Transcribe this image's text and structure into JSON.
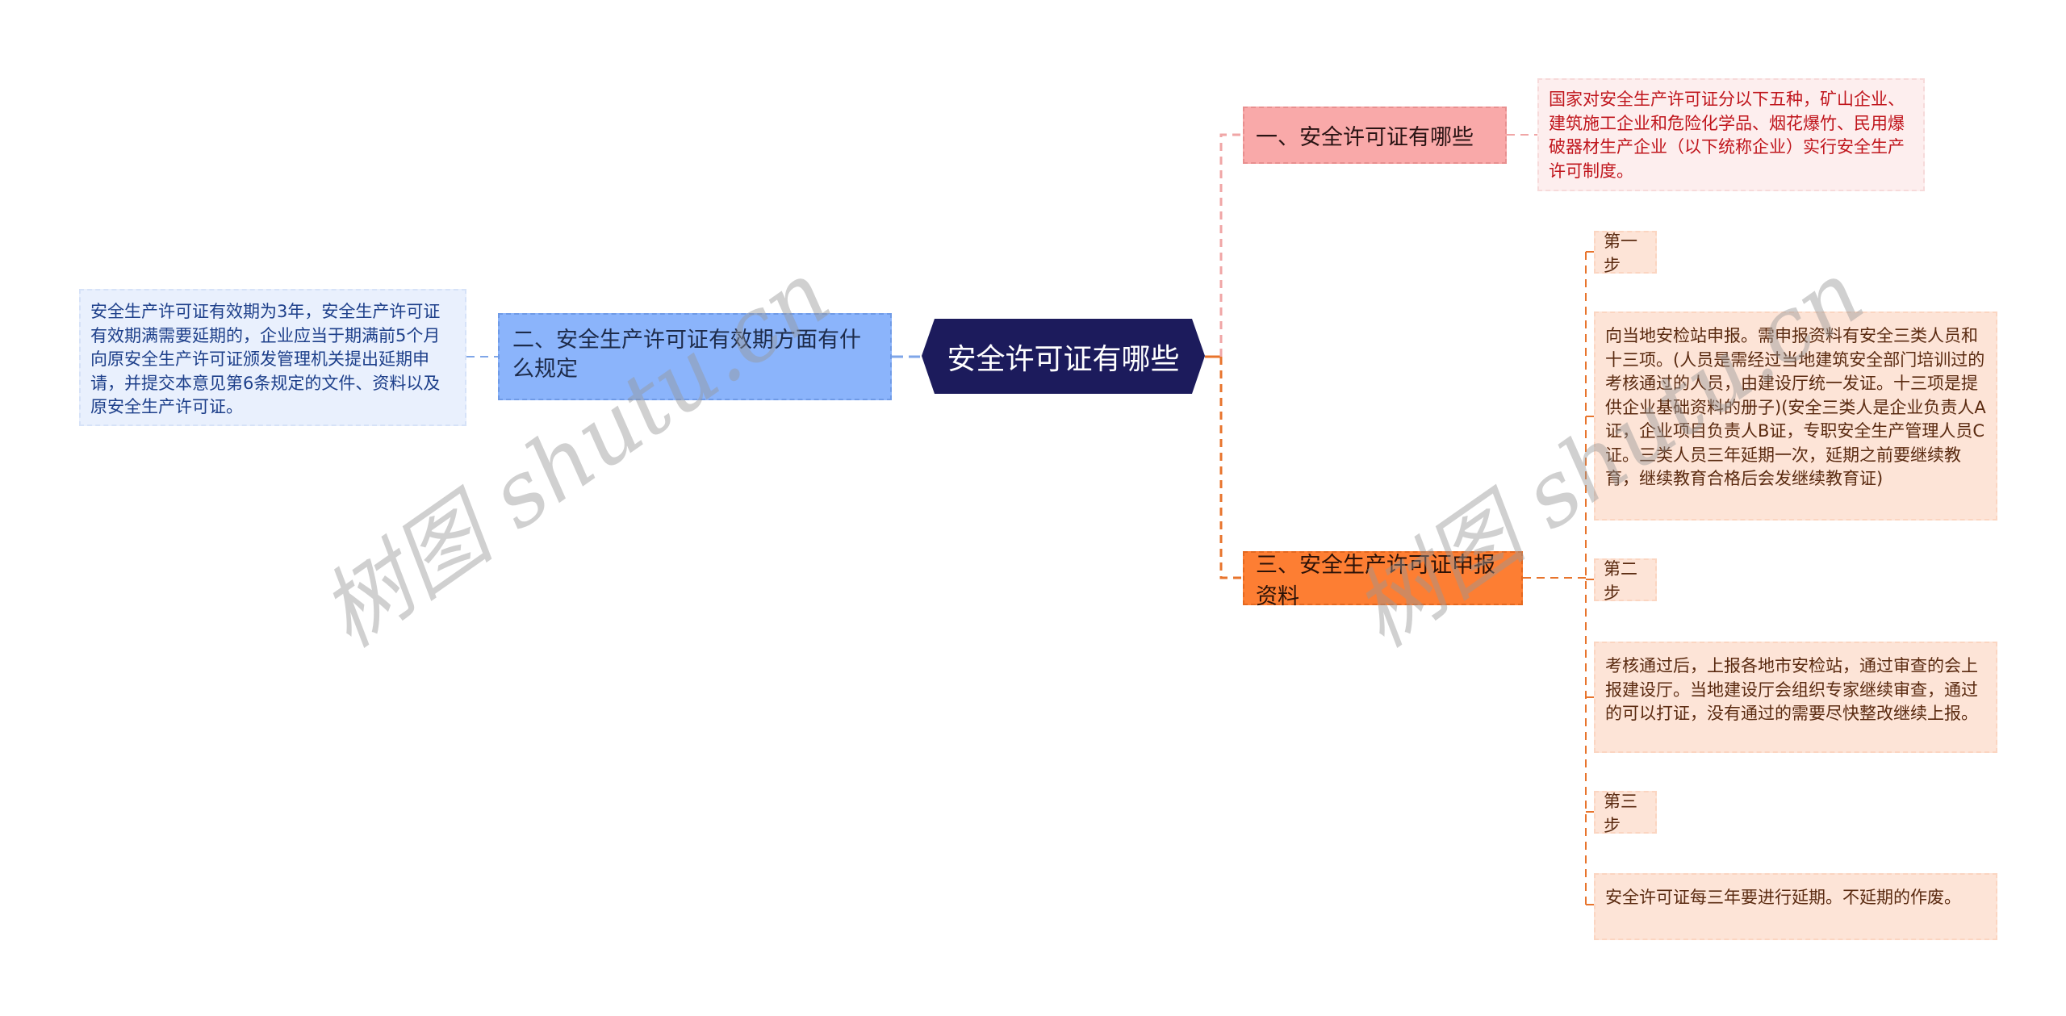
{
  "mindmap": {
    "root": {
      "label": "安全许可证有哪些",
      "color": "#1c1b5c"
    },
    "branches": [
      {
        "label": "一、安全许可证有哪些",
        "color": "#f9a9a9",
        "description": "国家对安全生产许可证分以下五种，矿山企业、建筑施工企业和危险化学品、烟花爆竹、民用爆破器材生产企业（以下统称企业）实行安全生产许可制度。"
      },
      {
        "label": "二、安全生产许可证有效期方面有什么规定",
        "color": "#8bb4fb",
        "description": "安全生产许可证有效期为3年，安全生产许可证有效期满需要延期的，企业应当于期满前5个月向原安全生产许可证颁发管理机关提出延期申请，并提交本意见第6条规定的文件、资料以及原安全生产许可证。"
      },
      {
        "label": "三、安全生产许可证申报资料",
        "color": "#fd7e33",
        "children": [
          {
            "label": "第一步"
          },
          {
            "label": "向当地安检站申报。需申报资料有安全三类人员和十三项。(人员是需经过当地建筑安全部门培训过的考核通过的人员，由建设厅统一发证。十三项是提供企业基础资料的册子)(安全三类人是企业负责人A证，企业项目负责人B证，专职安全生产管理人员C证。三类人员三年延期一次，延期之前要继续教育，继续教育合格后会发继续教育证)"
          },
          {
            "label": "第二步"
          },
          {
            "label": "考核通过后，上报各地市安检站，通过审查的会上报建设厅。当地建设厅会组织专家继续审查，通过的可以打证，没有通过的需要尽快整改继续上报。"
          },
          {
            "label": "第三步"
          },
          {
            "label": "安全许可证每三年要进行延期。不延期的作废。"
          }
        ]
      }
    ]
  },
  "watermark": "树图 shutu.cn"
}
